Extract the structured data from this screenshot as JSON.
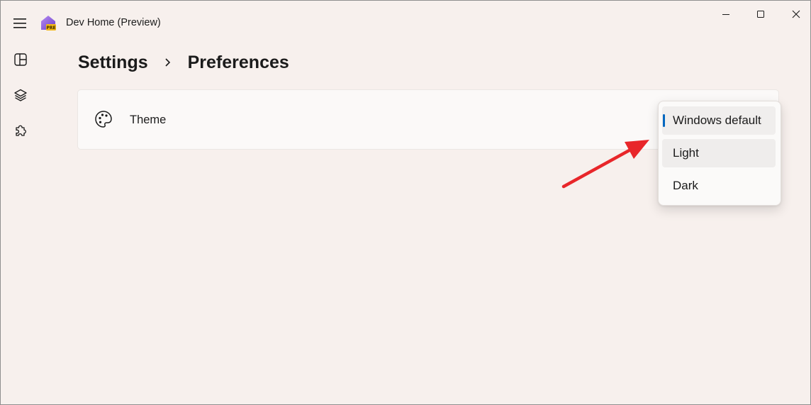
{
  "app": {
    "title": "Dev Home (Preview)",
    "logo_badge": "PRE"
  },
  "window_controls": {
    "minimize": "minimize-icon",
    "maximize": "maximize-icon",
    "close": "close-icon"
  },
  "nav": {
    "items": [
      {
        "icon": "dashboard-icon"
      },
      {
        "icon": "layers-icon"
      },
      {
        "icon": "puzzle-icon"
      }
    ]
  },
  "breadcrumb": {
    "root": "Settings",
    "current": "Preferences"
  },
  "theme_setting": {
    "icon": "palette-icon",
    "label": "Theme",
    "options": [
      "Windows default",
      "Light",
      "Dark"
    ],
    "selected": "Windows default"
  },
  "colors": {
    "accent": "#0067c0",
    "annotation_arrow": "#e8262a"
  }
}
